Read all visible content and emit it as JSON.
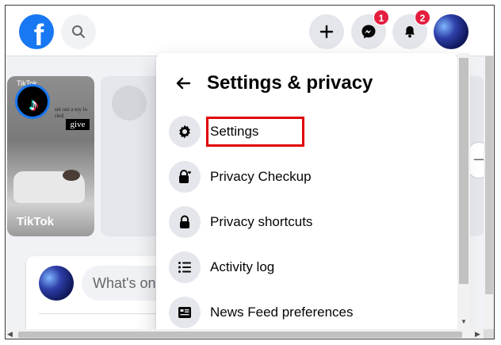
{
  "header": {
    "logo_letter": "f",
    "messenger_badge": "1",
    "notifications_badge": "2"
  },
  "stories": {
    "card_name": "TikTok",
    "card_tag": "give",
    "card_logo_text": "TikTok",
    "card_caption": "set out a toy lo ried."
  },
  "composer": {
    "placeholder": "What's on"
  },
  "settings_panel": {
    "title": "Settings & privacy",
    "items": [
      {
        "label": "Settings",
        "icon": "gear-icon",
        "highlighted": true
      },
      {
        "label": "Privacy Checkup",
        "icon": "lock-heart-icon"
      },
      {
        "label": "Privacy shortcuts",
        "icon": "lock-icon"
      },
      {
        "label": "Activity log",
        "icon": "list-icon"
      },
      {
        "label": "News Feed preferences",
        "icon": "news-feed-icon"
      }
    ]
  },
  "colors": {
    "brand_blue": "#1877f2",
    "badge_red": "#e41e3f",
    "highlight_red": "#e00000"
  }
}
